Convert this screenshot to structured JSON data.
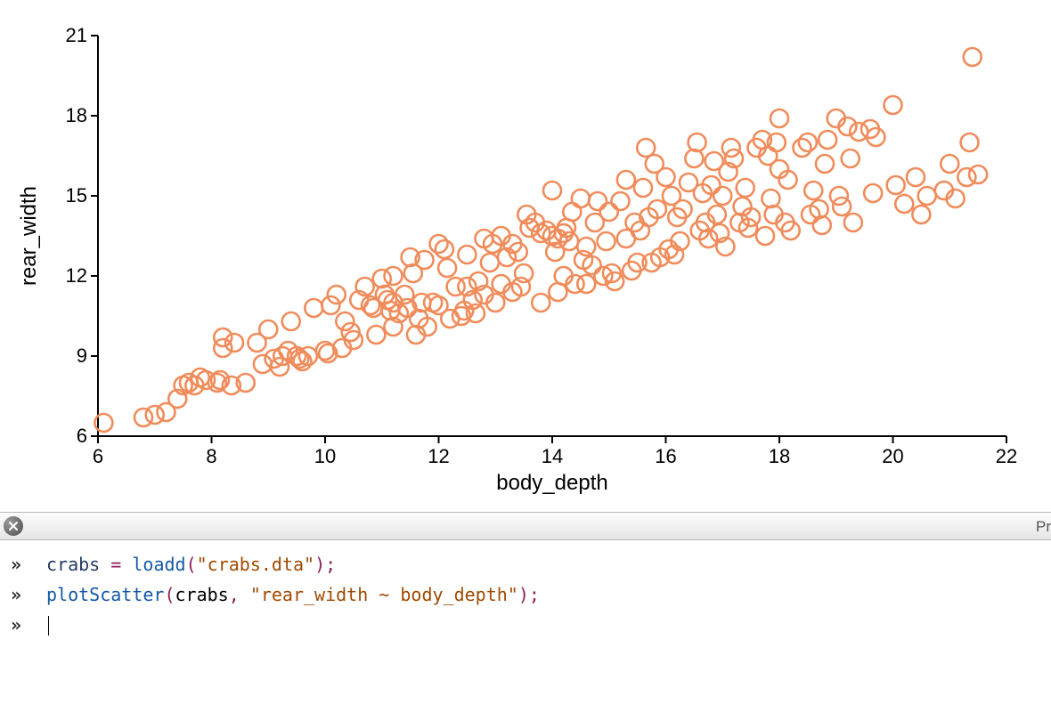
{
  "chart_data": {
    "type": "scatter",
    "xlabel": "body_depth",
    "ylabel": "rear_width",
    "xlim": [
      6,
      22
    ],
    "ylim": [
      6,
      21
    ],
    "x_ticks": [
      6,
      8,
      10,
      12,
      14,
      16,
      18,
      20,
      22
    ],
    "y_ticks": [
      6,
      9,
      12,
      15,
      18,
      21
    ],
    "marker_color": "#f08c5b",
    "marker_radius": 10,
    "series": [
      {
        "name": "crabs",
        "points": [
          [
            6.1,
            6.5
          ],
          [
            6.8,
            6.7
          ],
          [
            7.0,
            6.8
          ],
          [
            7.2,
            6.9
          ],
          [
            7.4,
            7.4
          ],
          [
            7.5,
            7.9
          ],
          [
            7.6,
            8.0
          ],
          [
            7.7,
            7.9
          ],
          [
            7.8,
            8.2
          ],
          [
            7.9,
            8.1
          ],
          [
            8.1,
            8.0
          ],
          [
            8.15,
            8.1
          ],
          [
            8.2,
            9.7
          ],
          [
            8.2,
            9.3
          ],
          [
            8.35,
            7.9
          ],
          [
            8.4,
            9.5
          ],
          [
            8.6,
            8.0
          ],
          [
            8.8,
            9.5
          ],
          [
            8.9,
            8.7
          ],
          [
            9.0,
            10.0
          ],
          [
            9.1,
            8.9
          ],
          [
            9.2,
            8.6
          ],
          [
            9.25,
            9.0
          ],
          [
            9.35,
            9.2
          ],
          [
            9.4,
            10.3
          ],
          [
            9.5,
            9.0
          ],
          [
            9.55,
            8.9
          ],
          [
            9.6,
            8.8
          ],
          [
            9.7,
            9.0
          ],
          [
            9.8,
            10.8
          ],
          [
            10.0,
            9.2
          ],
          [
            10.05,
            9.1
          ],
          [
            10.1,
            10.9
          ],
          [
            10.2,
            11.3
          ],
          [
            10.3,
            9.3
          ],
          [
            10.35,
            10.3
          ],
          [
            10.45,
            9.9
          ],
          [
            10.5,
            9.6
          ],
          [
            10.6,
            11.1
          ],
          [
            10.7,
            11.6
          ],
          [
            10.8,
            10.9
          ],
          [
            10.85,
            10.8
          ],
          [
            10.9,
            9.8
          ],
          [
            11.0,
            11.9
          ],
          [
            11.05,
            11.3
          ],
          [
            11.1,
            11.1
          ],
          [
            11.15,
            10.7
          ],
          [
            11.2,
            11.0
          ],
          [
            11.2,
            10.1
          ],
          [
            11.2,
            12.0
          ],
          [
            11.3,
            10.6
          ],
          [
            11.4,
            11.3
          ],
          [
            11.45,
            10.8
          ],
          [
            11.5,
            12.7
          ],
          [
            11.55,
            12.1
          ],
          [
            11.6,
            9.8
          ],
          [
            11.65,
            10.4
          ],
          [
            11.7,
            11.0
          ],
          [
            11.75,
            12.6
          ],
          [
            11.8,
            10.1
          ],
          [
            11.9,
            11.0
          ],
          [
            12.0,
            10.9
          ],
          [
            12.0,
            13.2
          ],
          [
            12.1,
            13.0
          ],
          [
            12.15,
            12.3
          ],
          [
            12.2,
            10.4
          ],
          [
            12.3,
            11.6
          ],
          [
            12.4,
            10.5
          ],
          [
            12.45,
            10.7
          ],
          [
            12.5,
            11.6
          ],
          [
            12.5,
            12.8
          ],
          [
            12.6,
            11.1
          ],
          [
            12.65,
            10.6
          ],
          [
            12.7,
            11.8
          ],
          [
            12.8,
            13.4
          ],
          [
            12.8,
            11.3
          ],
          [
            12.9,
            12.5
          ],
          [
            12.95,
            13.2
          ],
          [
            13.0,
            11.0
          ],
          [
            13.1,
            11.7
          ],
          [
            13.1,
            13.5
          ],
          [
            13.2,
            12.7
          ],
          [
            13.3,
            11.4
          ],
          [
            13.3,
            13.2
          ],
          [
            13.4,
            12.9
          ],
          [
            13.45,
            11.6
          ],
          [
            13.5,
            12.1
          ],
          [
            13.55,
            14.3
          ],
          [
            13.6,
            13.8
          ],
          [
            13.7,
            14.0
          ],
          [
            13.8,
            11.0
          ],
          [
            13.8,
            13.6
          ],
          [
            13.9,
            13.7
          ],
          [
            14.0,
            13.5
          ],
          [
            14.0,
            15.2
          ],
          [
            14.05,
            12.9
          ],
          [
            14.1,
            13.4
          ],
          [
            14.1,
            11.4
          ],
          [
            14.2,
            13.6
          ],
          [
            14.2,
            12.0
          ],
          [
            14.25,
            13.8
          ],
          [
            14.3,
            13.3
          ],
          [
            14.35,
            14.4
          ],
          [
            14.4,
            11.7
          ],
          [
            14.5,
            14.9
          ],
          [
            14.55,
            12.6
          ],
          [
            14.6,
            13.1
          ],
          [
            14.6,
            11.7
          ],
          [
            14.7,
            12.4
          ],
          [
            14.75,
            14.0
          ],
          [
            14.8,
            14.8
          ],
          [
            14.9,
            12.0
          ],
          [
            14.95,
            13.3
          ],
          [
            15.0,
            14.4
          ],
          [
            15.05,
            12.1
          ],
          [
            15.1,
            11.8
          ],
          [
            15.2,
            14.8
          ],
          [
            15.3,
            13.4
          ],
          [
            15.3,
            15.6
          ],
          [
            15.4,
            12.2
          ],
          [
            15.45,
            14.0
          ],
          [
            15.5,
            12.5
          ],
          [
            15.55,
            13.7
          ],
          [
            15.6,
            15.3
          ],
          [
            15.65,
            16.8
          ],
          [
            15.7,
            14.2
          ],
          [
            15.75,
            12.5
          ],
          [
            15.8,
            16.2
          ],
          [
            15.85,
            14.5
          ],
          [
            15.9,
            12.7
          ],
          [
            16.0,
            15.7
          ],
          [
            16.05,
            13.0
          ],
          [
            16.1,
            15.0
          ],
          [
            16.15,
            12.8
          ],
          [
            16.2,
            14.2
          ],
          [
            16.25,
            13.3
          ],
          [
            16.3,
            14.5
          ],
          [
            16.4,
            15.5
          ],
          [
            16.5,
            16.4
          ],
          [
            16.55,
            17.0
          ],
          [
            16.6,
            13.7
          ],
          [
            16.65,
            15.1
          ],
          [
            16.7,
            14.0
          ],
          [
            16.75,
            13.4
          ],
          [
            16.8,
            15.4
          ],
          [
            16.85,
            16.3
          ],
          [
            16.9,
            14.3
          ],
          [
            16.95,
            13.6
          ],
          [
            17.0,
            15.0
          ],
          [
            17.05,
            13.1
          ],
          [
            17.1,
            15.9
          ],
          [
            17.15,
            16.8
          ],
          [
            17.2,
            16.4
          ],
          [
            17.3,
            14.0
          ],
          [
            17.35,
            14.6
          ],
          [
            17.4,
            15.3
          ],
          [
            17.45,
            13.8
          ],
          [
            17.5,
            14.2
          ],
          [
            17.6,
            16.8
          ],
          [
            17.7,
            17.1
          ],
          [
            17.75,
            13.5
          ],
          [
            17.8,
            16.5
          ],
          [
            17.85,
            14.9
          ],
          [
            17.9,
            14.3
          ],
          [
            17.95,
            17.0
          ],
          [
            18.0,
            17.9
          ],
          [
            18.0,
            16.0
          ],
          [
            18.1,
            14.0
          ],
          [
            18.15,
            15.6
          ],
          [
            18.2,
            13.7
          ],
          [
            18.4,
            16.8
          ],
          [
            18.5,
            17.0
          ],
          [
            18.55,
            14.3
          ],
          [
            18.6,
            15.2
          ],
          [
            18.7,
            14.5
          ],
          [
            18.75,
            13.9
          ],
          [
            18.8,
            16.2
          ],
          [
            18.85,
            17.1
          ],
          [
            19.0,
            17.9
          ],
          [
            19.05,
            15.0
          ],
          [
            19.1,
            14.6
          ],
          [
            19.2,
            17.6
          ],
          [
            19.25,
            16.4
          ],
          [
            19.3,
            14.0
          ],
          [
            19.4,
            17.4
          ],
          [
            19.6,
            17.5
          ],
          [
            19.65,
            15.1
          ],
          [
            19.7,
            17.2
          ],
          [
            20.0,
            18.4
          ],
          [
            20.05,
            15.4
          ],
          [
            20.2,
            14.7
          ],
          [
            20.4,
            15.7
          ],
          [
            20.5,
            14.3
          ],
          [
            20.6,
            15.0
          ],
          [
            20.9,
            15.2
          ],
          [
            21.0,
            16.2
          ],
          [
            21.1,
            14.9
          ],
          [
            21.3,
            15.7
          ],
          [
            21.35,
            17.0
          ],
          [
            21.4,
            20.2
          ],
          [
            21.5,
            15.8
          ]
        ]
      }
    ]
  },
  "toolbar": {
    "right_label_partial": "Pr"
  },
  "console": {
    "prompt_glyph": "»",
    "lines": [
      {
        "tokens": [
          {
            "text": "crabs",
            "cls": "tk-name"
          },
          {
            "text": " "
          },
          {
            "text": "=",
            "cls": "tk-op"
          },
          {
            "text": " "
          },
          {
            "text": "loadd",
            "cls": "tk-func"
          },
          {
            "text": "(",
            "cls": "tk-punct"
          },
          {
            "text": "\"crabs.dta\"",
            "cls": "tk-str"
          },
          {
            "text": ")",
            "cls": "tk-punct"
          },
          {
            "text": ";",
            "cls": "tk-punct"
          }
        ]
      },
      {
        "tokens": [
          {
            "text": "plotScatter",
            "cls": "tk-func"
          },
          {
            "text": "(",
            "cls": "tk-punct"
          },
          {
            "text": "crabs",
            "cls": "tk-plain"
          },
          {
            "text": ",",
            "cls": "tk-punct"
          },
          {
            "text": " "
          },
          {
            "text": "\"rear_width ~ body_depth\"",
            "cls": "tk-str"
          },
          {
            "text": ")",
            "cls": "tk-punct"
          },
          {
            "text": ";",
            "cls": "tk-punct"
          }
        ]
      },
      {
        "tokens": [],
        "cursor": true
      }
    ]
  }
}
